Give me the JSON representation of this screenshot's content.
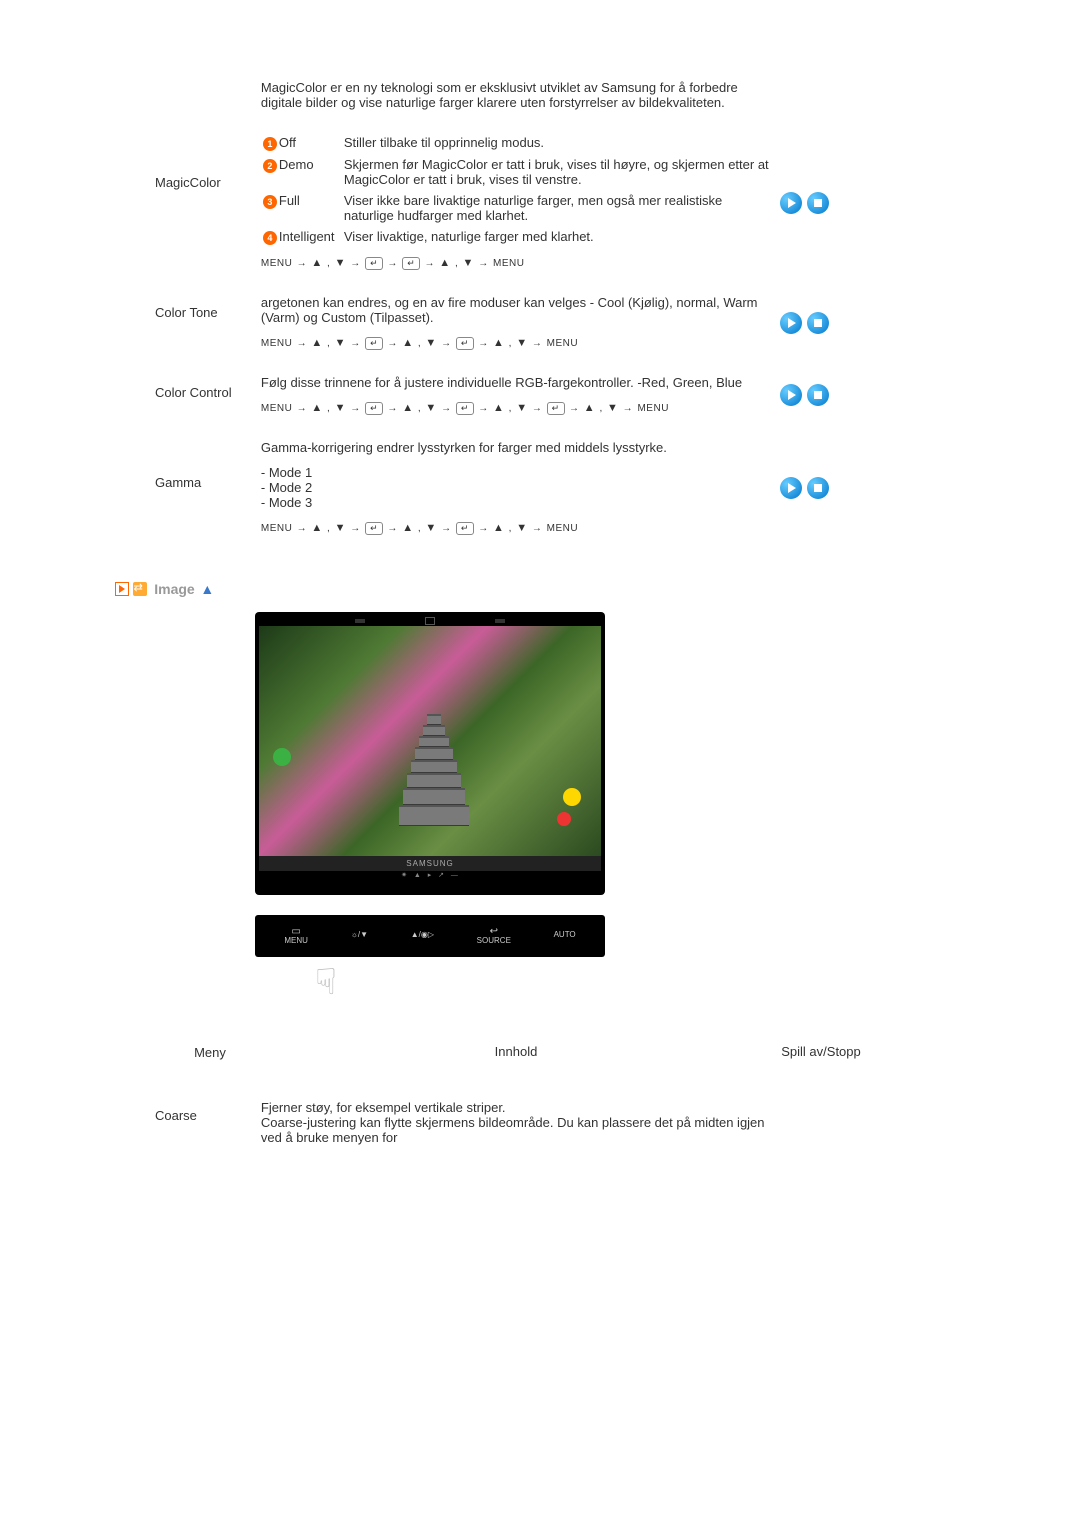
{
  "intro": "MagicColor er en ny teknologi som er eksklusivt utviklet av Samsung for å forbedre digitale bilder og vise naturlige farger klarere uten forstyrrelser av bildekvaliteten.",
  "rows": {
    "magiccolor": {
      "label": "MagicColor",
      "options": [
        {
          "n": "1",
          "name": "Off",
          "desc": "Stiller tilbake til opprinnelig modus."
        },
        {
          "n": "2",
          "name": "Demo",
          "desc": "Skjermen før MagicColor er tatt i bruk, vises til høyre, og skjermen etter at MagicColor er tatt i bruk, vises til venstre."
        },
        {
          "n": "3",
          "name": "Full",
          "desc": "Viser ikke bare livaktige naturlige farger, men også mer realistiske naturlige hudfarger med klarhet."
        },
        {
          "n": "4",
          "name": "Intelligent",
          "desc": "Viser livaktige, naturlige farger med klarhet."
        }
      ],
      "path_prefix": "MENU → ",
      "path_mid1": " , ",
      "path_arrow": "→",
      "path_enter": "↵",
      "path_suffix": " → MENU"
    },
    "colortone": {
      "label": "Color Tone",
      "desc": "argetonen kan endres, og en av fire moduser kan velges - Cool (Kjølig), normal, Warm (Varm) og Custom (Tilpasset)."
    },
    "colorcontrol": {
      "label": "Color Control",
      "desc": "Følg disse trinnene for å justere individuelle RGB-fargekontroller. -Red, Green, Blue"
    },
    "gamma": {
      "label": "Gamma",
      "desc": "Gamma-korrigering endrer lysstyrken for farger med middels lysstyrke.",
      "modes": [
        "- Mode 1",
        "- Mode 2",
        "- Mode 3"
      ]
    },
    "coarse": {
      "label": "Coarse",
      "desc": "Fjerner støy, for eksempel vertikale striper.\nCoarse-justering kan flytte skjermens bildeområde. Du kan plassere det på midten igjen ved å bruke menyen for"
    }
  },
  "nav_path": {
    "menu": "MENU",
    "up": "▲",
    "down": "▼",
    "sep": " , ",
    "arrow": " → "
  },
  "section": {
    "title": "Image"
  },
  "tv": {
    "brand": "SAMSUNG"
  },
  "button_bar": {
    "menu_top": "▭",
    "menu": "MENU",
    "bright": "☼/▼",
    "vol": "▲/◉▷",
    "source_top": "↩",
    "source": "SOURCE",
    "auto": "AUTO"
  },
  "table_heads": {
    "left": "Meny",
    "mid": "Innhold",
    "right": "Spill av/Stopp"
  },
  "icon_names": {
    "play": "play",
    "stop": "stop"
  }
}
